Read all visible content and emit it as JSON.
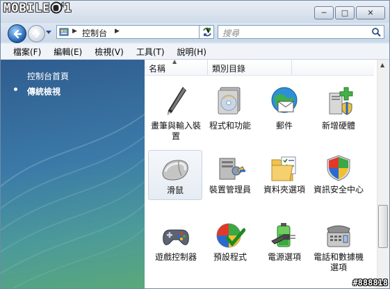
{
  "watermark_brand": "MOBILE01",
  "window": {
    "minimize": "─",
    "maximize": "□",
    "close": "✕"
  },
  "address": {
    "path": "控制台",
    "search_placeholder": "搜尋"
  },
  "menu": [
    "檔案(F)",
    "編輯(E)",
    "檢視(V)",
    "工具(T)",
    "說明(H)"
  ],
  "left_pane": {
    "home_link": "控制台首頁",
    "current_view": "傳統檢視"
  },
  "columns": {
    "name": "名稱",
    "category": "類別目錄"
  },
  "items": [
    {
      "label": "畫筆與輸入裝置",
      "icon": "pen-icon"
    },
    {
      "label": "程式和功能",
      "icon": "programs-icon"
    },
    {
      "label": "郵件",
      "icon": "mail-icon"
    },
    {
      "label": "新增硬體",
      "icon": "add-hardware-icon"
    },
    {
      "label": "滑鼠",
      "icon": "mouse-icon",
      "selected": true
    },
    {
      "label": "裝置管理員",
      "icon": "device-manager-icon"
    },
    {
      "label": "資料夾選項",
      "icon": "folder-options-icon"
    },
    {
      "label": "資訊安全中心",
      "icon": "security-center-icon"
    },
    {
      "label": "遊戲控制器",
      "icon": "gamepad-icon"
    },
    {
      "label": "預設程式",
      "icon": "default-programs-icon"
    },
    {
      "label": "電源選項",
      "icon": "power-icon"
    },
    {
      "label": "電話和數據機選項",
      "icon": "phone-modem-icon"
    }
  ],
  "corner_tag": "#888818"
}
